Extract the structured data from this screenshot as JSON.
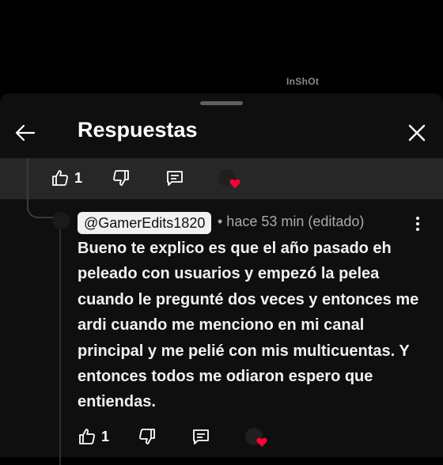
{
  "watermark": "InShOt",
  "header": {
    "title": "Respuestas"
  },
  "parent_actions": {
    "like_count": "1"
  },
  "reply": {
    "author": "@GamerEdits1820",
    "meta": "• hace 53 min (editado)",
    "text": "Bueno te explico es que el año pasado eh peleado con usuarios y empezó la pelea cuando le pregunté dos veces y entonces me ardi cuando me menciono en mi canal principal y me pelié con mis multicuentas. Y entonces todos me odiaron espero que entiendas.",
    "like_count": "1"
  },
  "colors": {
    "heart": "#ff0033",
    "sheet_bg": "#0f0f0f",
    "highlight_bg": "#272727"
  }
}
